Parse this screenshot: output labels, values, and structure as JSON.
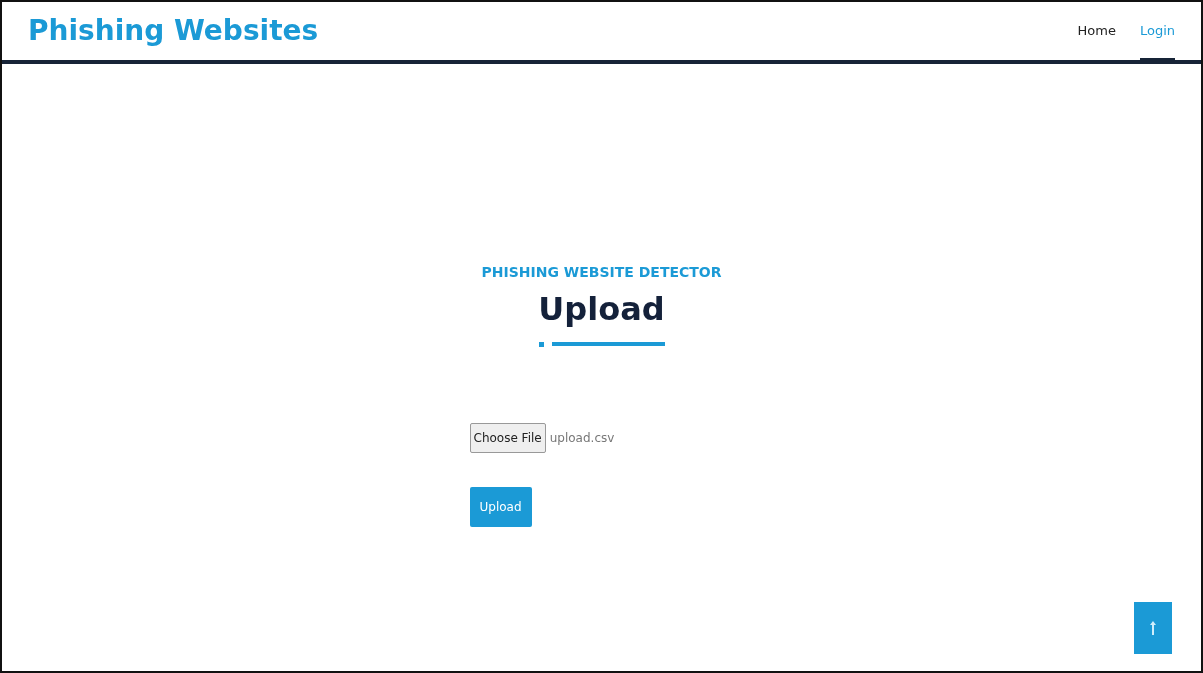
{
  "brand": "Phishing Websites",
  "nav": [
    {
      "label": "Home",
      "selected": false
    },
    {
      "label": "Login",
      "selected": true
    }
  ],
  "section": {
    "subtitle": "PHISHING WEBSITE DETECTOR",
    "title": "Upload"
  },
  "file_input": {
    "button": "Choose File",
    "filename": "upload.csv"
  },
  "submit_button": "Upload"
}
